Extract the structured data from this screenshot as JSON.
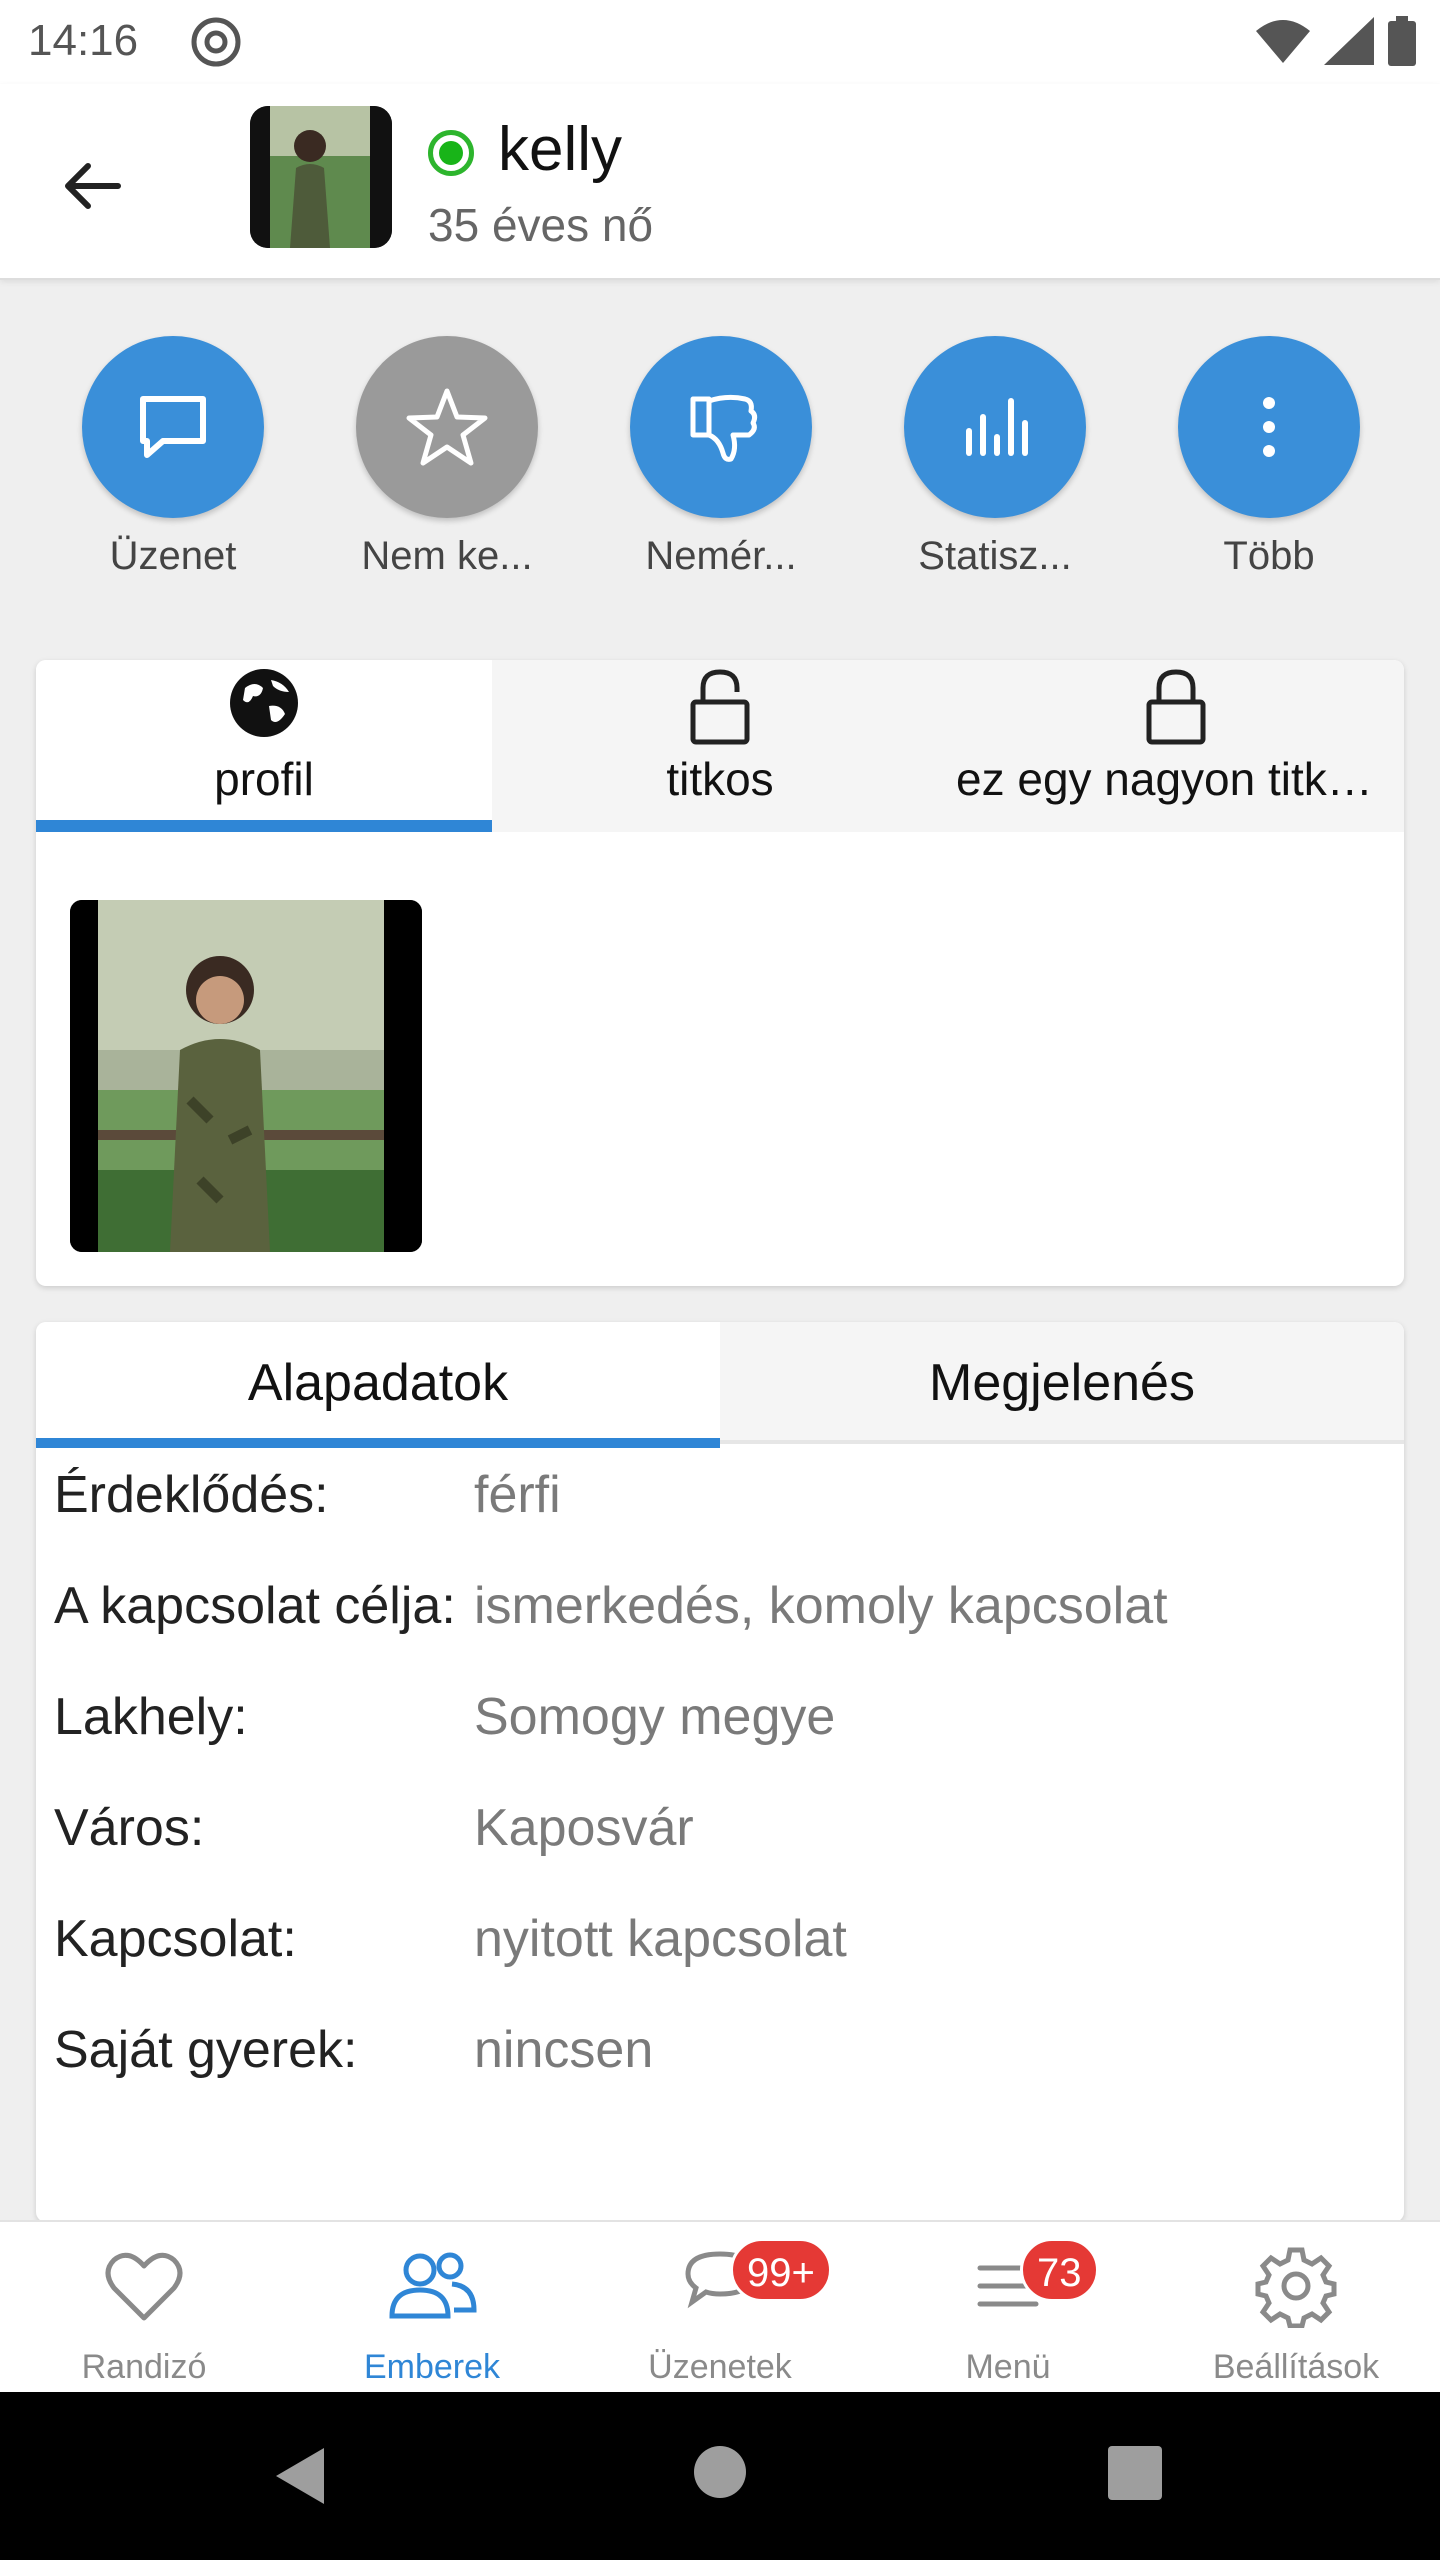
{
  "status_bar": {
    "time": "14:16",
    "icons": [
      "at-sign-icon",
      "wifi-icon",
      "signal-icon",
      "battery-icon"
    ]
  },
  "header": {
    "back_icon": "arrow-left-icon",
    "name": "kelly",
    "subtitle": "35 éves nő",
    "online_color": "#18b418"
  },
  "actions": [
    {
      "label": "Üzenet",
      "icon": "chat-bubble-icon",
      "color": "#3a8fd9"
    },
    {
      "label": "Nem ke...",
      "icon": "star-outline-icon",
      "color": "#9a9a9a"
    },
    {
      "label": "Nemér...",
      "icon": "thumbs-down-icon",
      "color": "#3a8fd9"
    },
    {
      "label": "Statisz...",
      "icon": "bar-chart-icon",
      "color": "#3a8fd9"
    },
    {
      "label": "Több",
      "icon": "more-vertical-icon",
      "color": "#3a8fd9"
    }
  ],
  "photo_tabs": [
    {
      "label": "profil",
      "icon": "globe-icon",
      "active": true
    },
    {
      "label": "titkos",
      "icon": "unlocked-icon",
      "active": false
    },
    {
      "label": "ez egy nagyon titkos...",
      "icon": "lock-icon",
      "active": false
    }
  ],
  "info_tabs": [
    {
      "label": "Alapadatok",
      "active": true
    },
    {
      "label": "Megjelenés",
      "active": false
    }
  ],
  "details": [
    {
      "key": "Érdeklődés:",
      "value": "férfi"
    },
    {
      "key": "A kapcsolat célja:",
      "value": "ismerkedés, komoly kapcsolat"
    },
    {
      "key": "Lakhely:",
      "value": "Somogy megye"
    },
    {
      "key": "Város:",
      "value": "Kaposvár"
    },
    {
      "key": "Kapcsolat:",
      "value": "nyitott kapcsolat"
    },
    {
      "key": "Saját gyerek:",
      "value": "nincsen"
    }
  ],
  "bottom_nav": [
    {
      "label": "Randizó",
      "icon": "heart-icon",
      "active": false,
      "badge": ""
    },
    {
      "label": "Emberek",
      "icon": "people-icon",
      "active": true,
      "badge": ""
    },
    {
      "label": "Üzenetek",
      "icon": "chat-icon",
      "active": false,
      "badge": "99+"
    },
    {
      "label": "Menü",
      "icon": "menu-icon",
      "active": false,
      "badge": "73"
    },
    {
      "label": "Beállítások",
      "icon": "gear-icon",
      "active": false,
      "badge": ""
    }
  ],
  "colors": {
    "accent": "#2f86d6",
    "badge": "#e53935"
  }
}
